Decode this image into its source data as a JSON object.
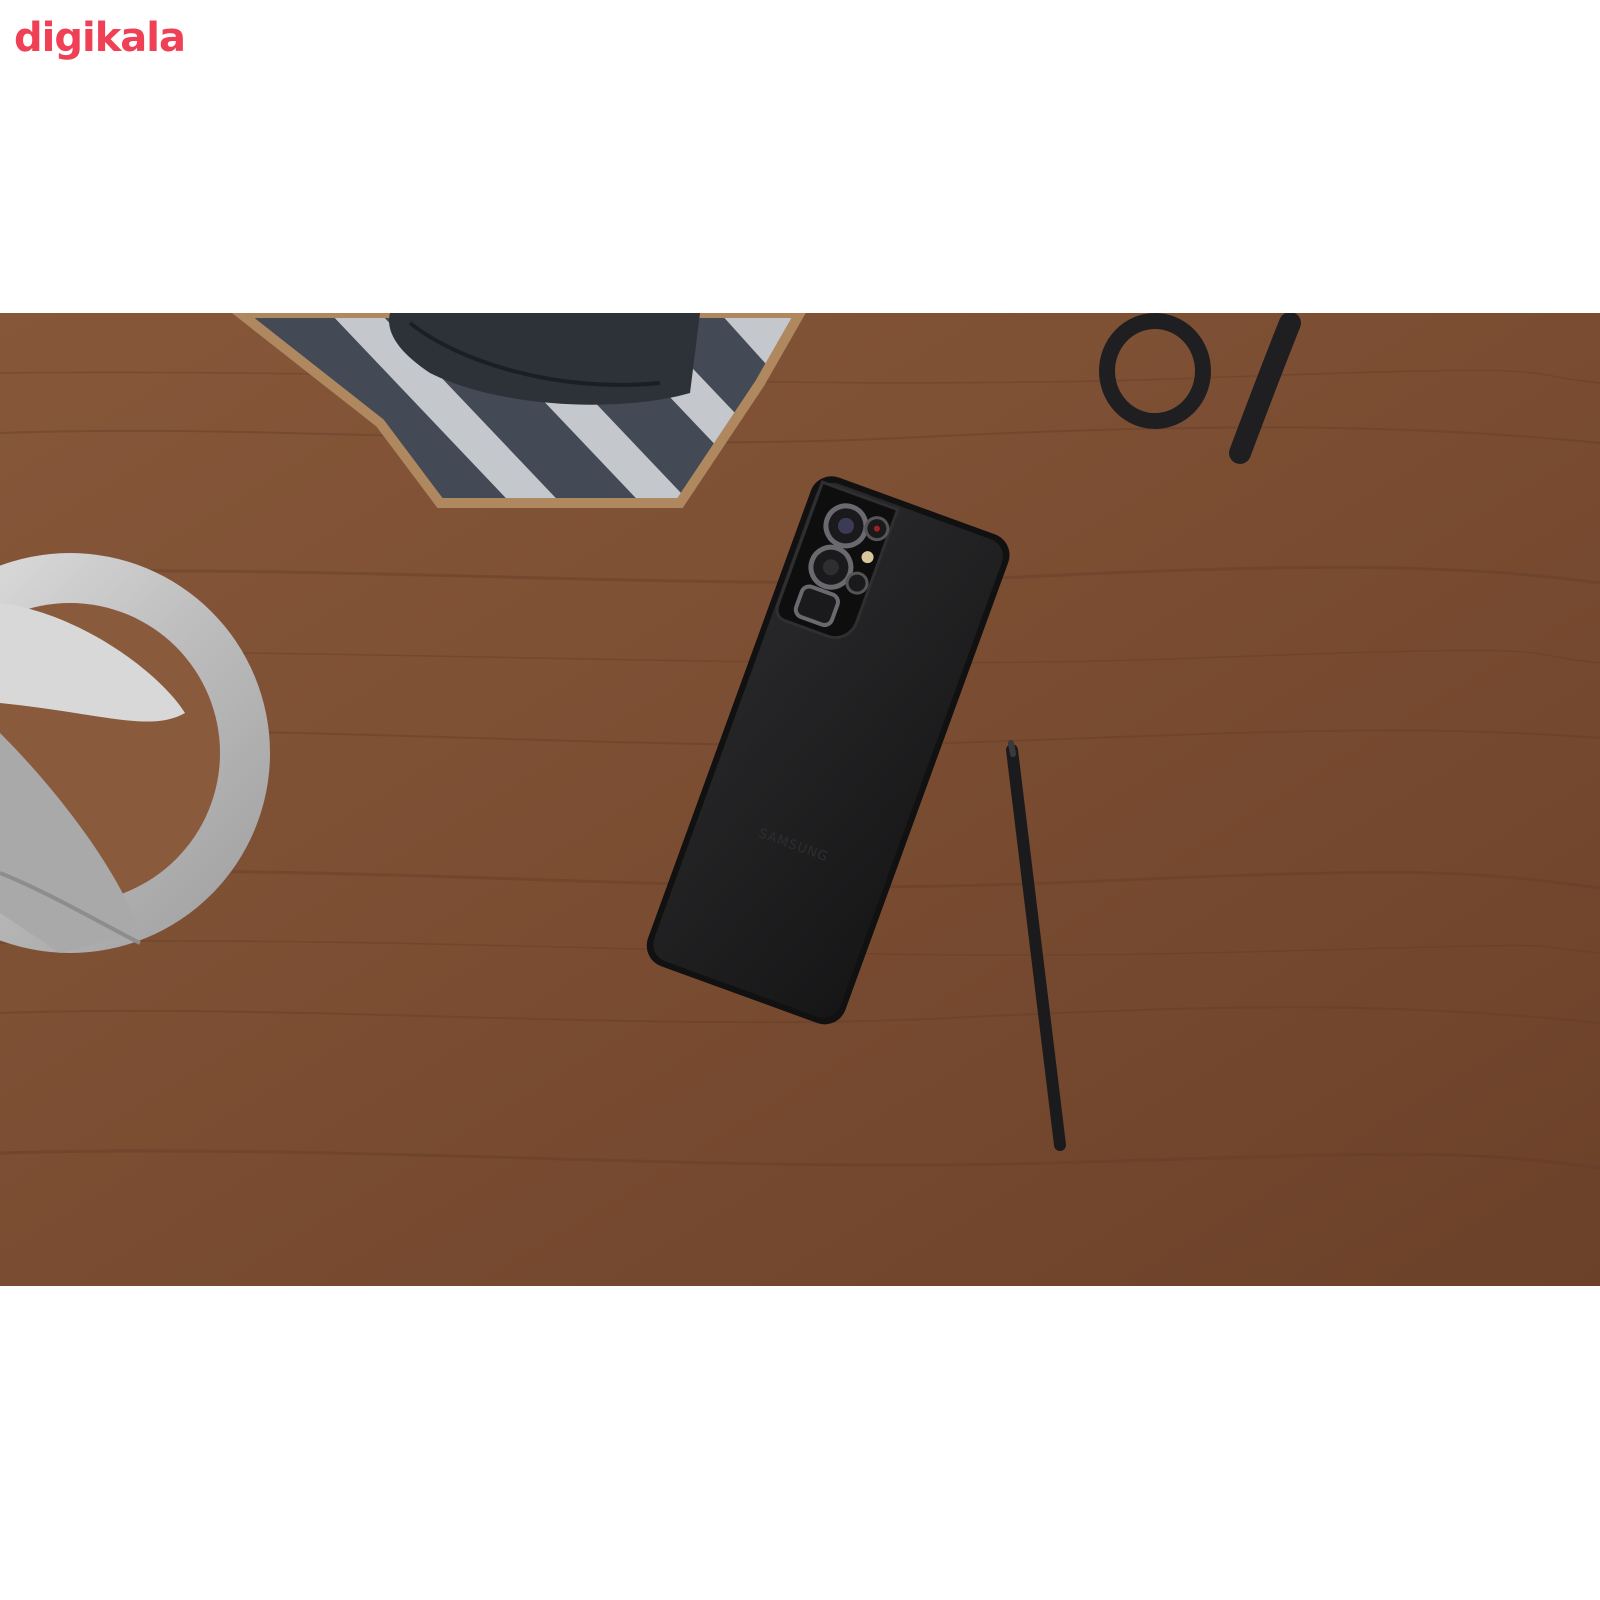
{
  "brand": {
    "name": "digikala",
    "color": "#ef4056"
  },
  "product_photo": {
    "phone_back_text": "SAMSUNG",
    "colors": {
      "wood": "#7a4e33",
      "wood_dark": "#5e3a24",
      "phone": "#1e1e1f",
      "metal": "#c9c9c9",
      "coaster_stripe_dark": "#444a55",
      "coaster_stripe_light": "#c4c7cb",
      "cork": "#b08860"
    }
  }
}
